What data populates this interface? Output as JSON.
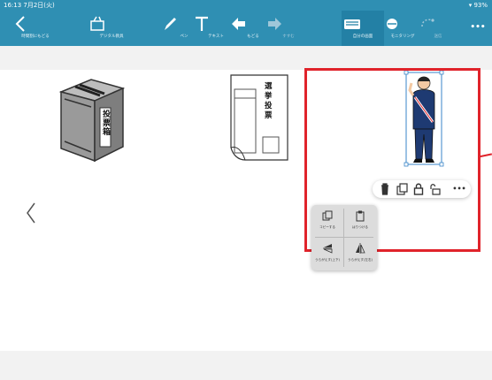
{
  "status_bar": {
    "time": "16:13  7月2日(火)",
    "battery": "93%"
  },
  "toolbar": {
    "back_label": "時間割にもどる",
    "digital_label": "デジタル教具",
    "pen_label": "ペン",
    "text_label": "テキスト",
    "undo_label": "もどる",
    "redo_label": "すすむ",
    "mypage_label": "自分の画面",
    "monitoring_label": "モニタリング",
    "share_label": "送信",
    "more_label": "•••"
  },
  "canvas": {
    "ballot_box_text": "投票箱",
    "ballot_paper_text": "選挙投票"
  },
  "context_menu": {
    "copy_label": "コピーする",
    "paste_label": "はりつける",
    "flip_vertical_label": "うらがえす(上下)",
    "flip_horizontal_label": "うらがえす(左右)"
  },
  "floating_bar": {
    "more_label": "•••"
  },
  "colors": {
    "toolbar": "#2f8fb3",
    "highlight": "#e0232b",
    "selection": "#3a86c8"
  }
}
